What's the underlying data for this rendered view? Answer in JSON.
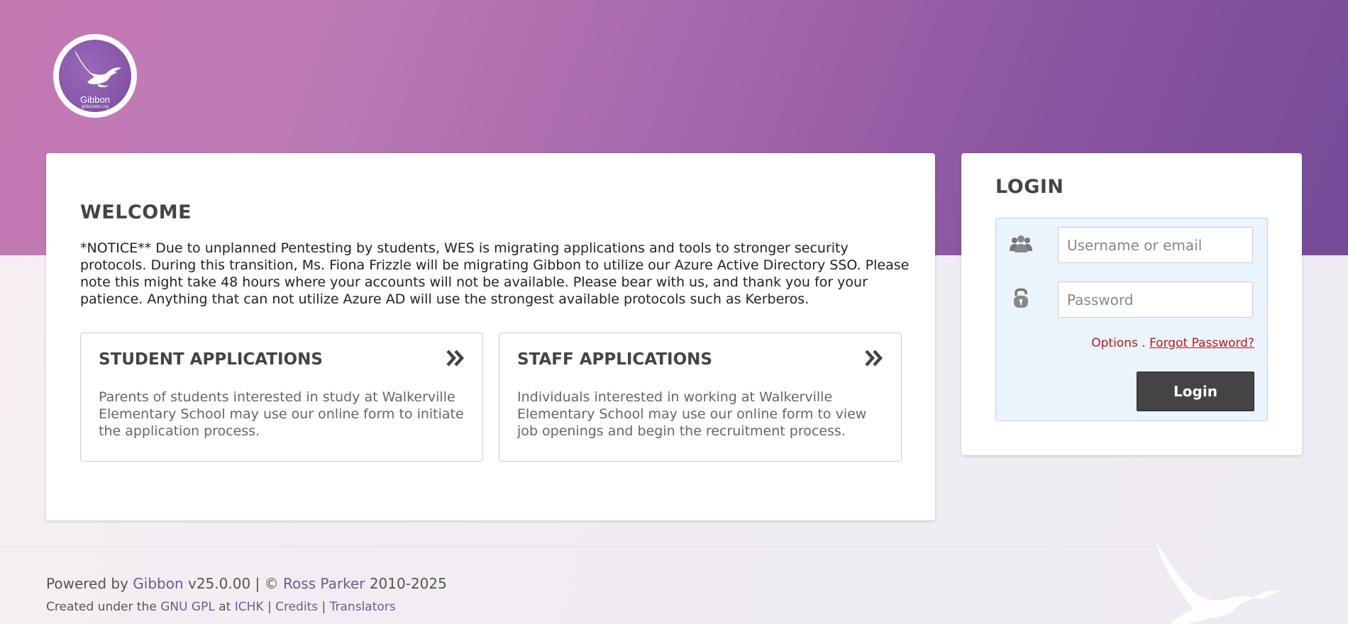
{
  "colors": {
    "accent": "#7a4ca0",
    "banner_start": "#c478b2",
    "banner_end": "#764b98",
    "link_red": "#c4161c",
    "button_dark": "#444444",
    "login_panel": "#ebf4fd"
  },
  "logo": {
    "name": "Gibbon",
    "url": "gibbonedu.org",
    "icon": "gibbon-silhouette-icon"
  },
  "welcome": {
    "title": "WELCOME",
    "notice": "*NOTICE** Due to unplanned Pentesting by students, WES is migrating applications and tools to stronger security protocols. During this transition, Ms. Fiona Frizzle will be migrating Gibbon to utilize our Azure Active Directory SSO. Please note this might take 48 hours where your accounts will not be available. Please bear with us, and thank you for your patience. Anything that can not utilize Azure AD will use the strongest available protocols such as Kerberos."
  },
  "applications": [
    {
      "title": "STUDENT APPLICATIONS",
      "description": "Parents of students interested in study at Walkerville Elementary School may use our online form to initiate the application process.",
      "icon": "double-chevron-right-icon"
    },
    {
      "title": "STAFF APPLICATIONS",
      "description": "Individuals interested in working at Walkerville Elementary School may use our online form to view job openings and begin the recruitment process.",
      "icon": "double-chevron-right-icon"
    }
  ],
  "login": {
    "title": "LOGIN",
    "username_placeholder": "Username or email",
    "password_placeholder": "Password",
    "username_icon": "users-icon",
    "password_icon": "lock-icon",
    "options_label": "Options",
    "separator": ".",
    "forgot_label": "Forgot Password?",
    "button_label": "Login"
  },
  "footer": {
    "powered_by": "Powered by",
    "app_name": "Gibbon",
    "version": "v25.0.00 |",
    "copyright": "©",
    "author": "Ross Parker",
    "years": "2010-2025",
    "created_under": "Created under the",
    "license": "GNU GPL",
    "at": "at",
    "org": "ICHK",
    "sep": "|",
    "credits": "Credits",
    "translators": "Translators"
  }
}
